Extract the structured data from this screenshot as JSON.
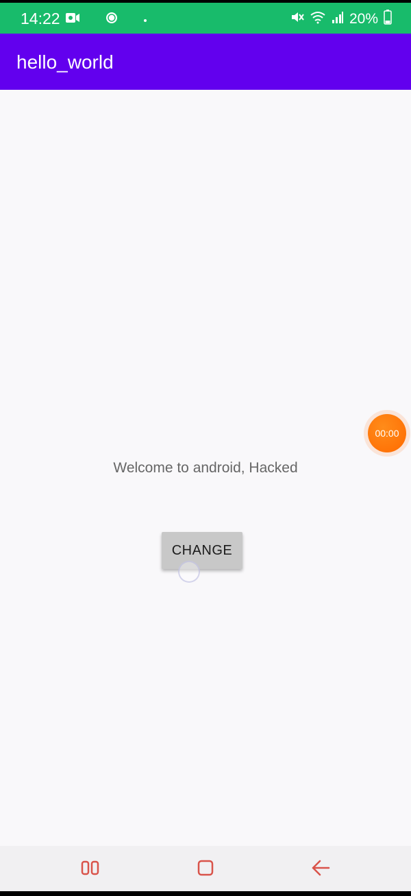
{
  "status_bar": {
    "time": "14:22",
    "battery": "20%",
    "icons": [
      "video-call-icon",
      "chat-bubble-icon",
      "dot-icon",
      "mute-icon",
      "wifi-icon",
      "signal-icon",
      "battery-icon"
    ]
  },
  "app_bar": {
    "title": "hello_world"
  },
  "main": {
    "welcome_text": "Welcome to android, Hacked",
    "change_button_label": "CHANGE"
  },
  "recorder": {
    "timer": "00:00",
    "color": "#ff7a0f"
  },
  "nav_bar": {
    "buttons": [
      "recent-apps",
      "home",
      "back"
    ],
    "icon_color": "#d9534a"
  },
  "colors": {
    "status_bar": "#18bb6b",
    "app_bar": "#6200ee",
    "background": "#f9f8fa",
    "button": "#c8c8c8"
  }
}
